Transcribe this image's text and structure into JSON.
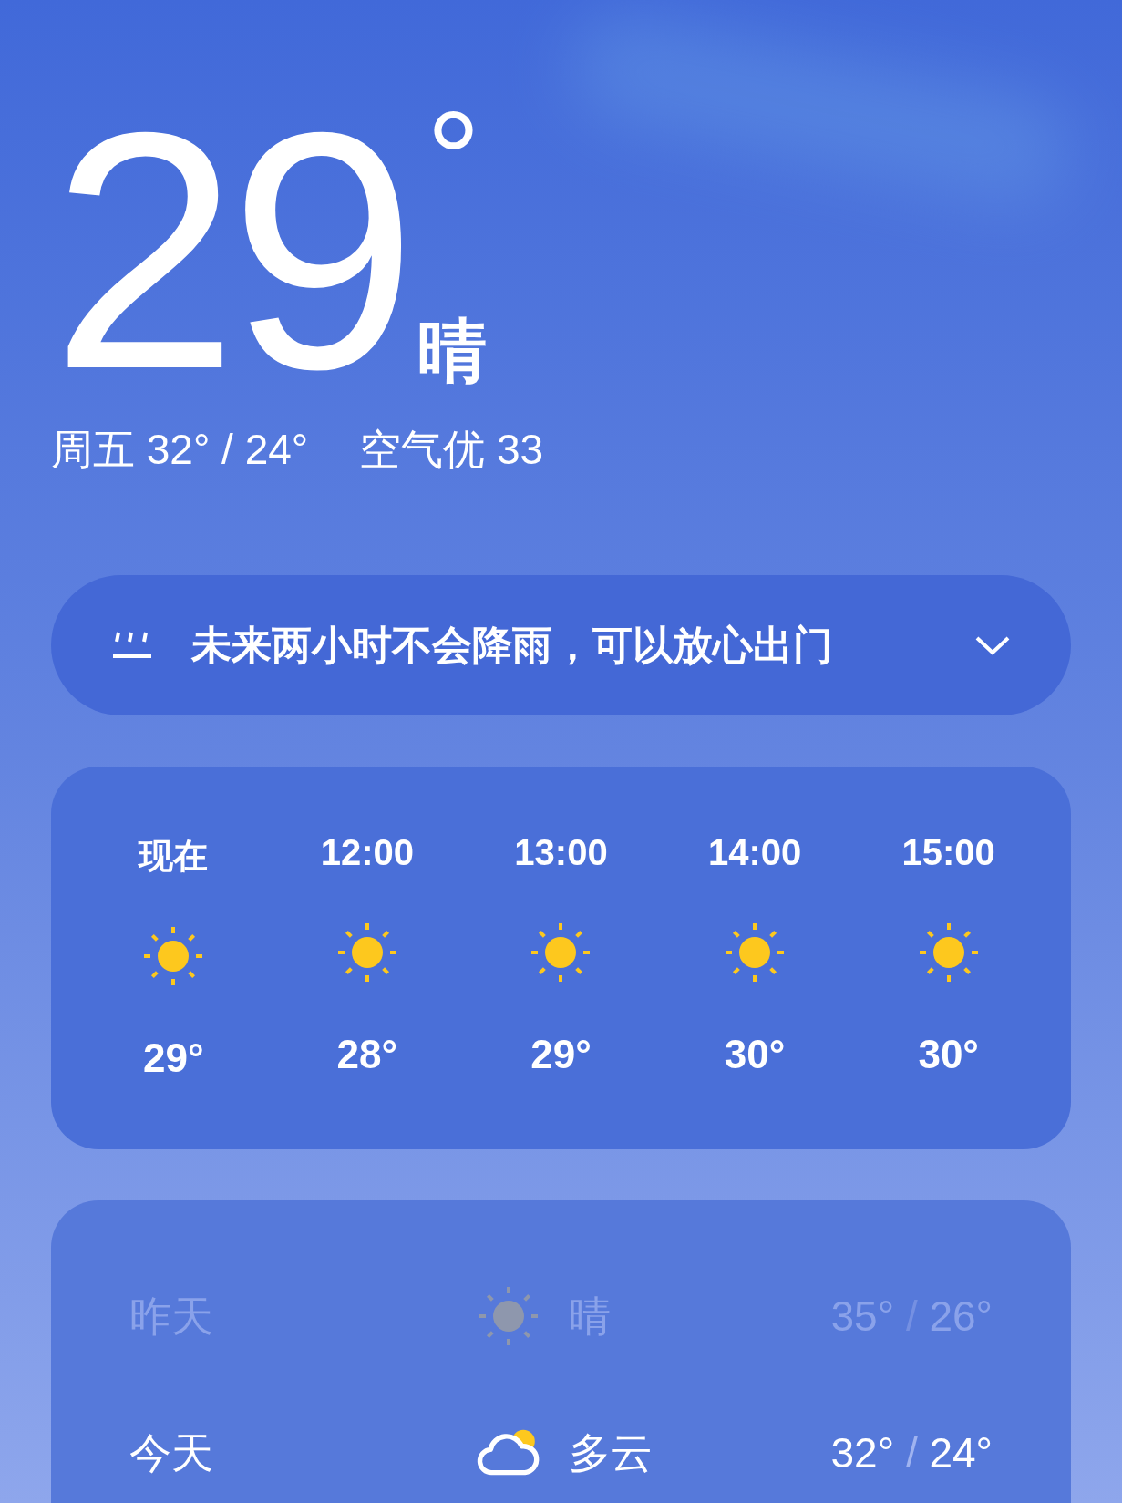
{
  "current": {
    "temperature": "29",
    "degree": "°",
    "condition": "晴"
  },
  "summary": {
    "day_range": "周五 32° / 24°",
    "air_quality": "空气优 33"
  },
  "rain_alert": {
    "text": "未来两小时不会降雨，可以放心出门",
    "expanded": false
  },
  "hourly": [
    {
      "time": "现在",
      "kind": "sun",
      "temp": "29°"
    },
    {
      "time": "12:00",
      "kind": "sun",
      "temp": "28°"
    },
    {
      "time": "13:00",
      "kind": "sun",
      "temp": "29°"
    },
    {
      "time": "14:00",
      "kind": "sun",
      "temp": "30°"
    },
    {
      "time": "15:00",
      "kind": "sun",
      "temp": "30°"
    }
  ],
  "daily": [
    {
      "day": "昨天",
      "kind": "sun",
      "condition": "晴",
      "high": "35°",
      "separator": "/",
      "low": "26°",
      "past": true
    },
    {
      "day": "今天",
      "kind": "partly-cloudy",
      "condition": "多云",
      "high": "32°",
      "separator": "/",
      "low": "24°",
      "past": false
    }
  ]
}
